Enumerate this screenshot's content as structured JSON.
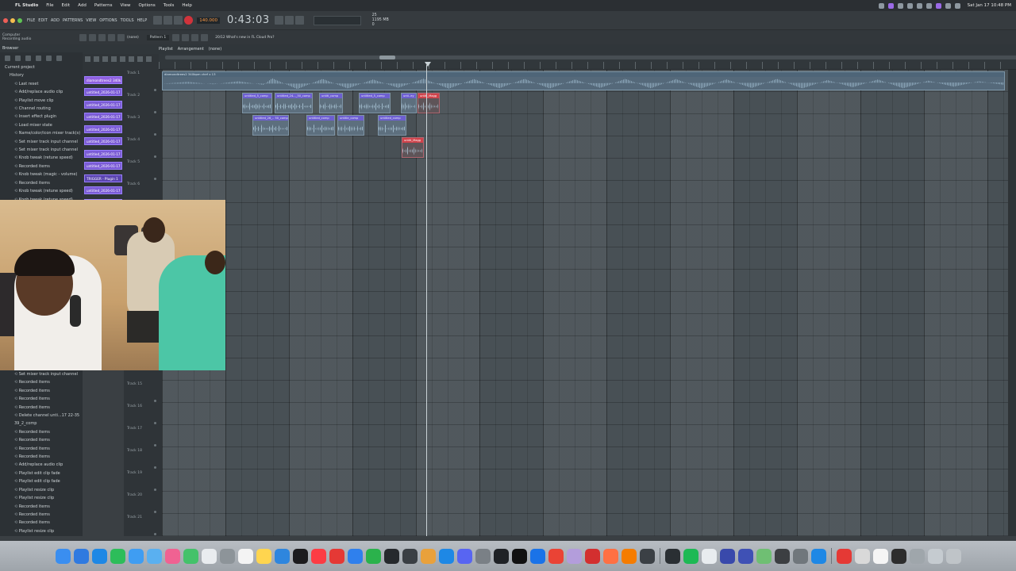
{
  "menubar": {
    "app": "FL Studio",
    "items": [
      "File",
      "Edit",
      "Add",
      "Patterns",
      "View",
      "Options",
      "Tools",
      "Help"
    ],
    "clock": "Sat Jan 17 10:48 PM"
  },
  "toolbar": {
    "menu": [
      "FILE",
      "EDIT",
      "ADD",
      "PATTERNS",
      "VIEW",
      "OPTIONS",
      "TOOLS",
      "HELP"
    ],
    "tempo": "140.000",
    "time": "0:43:03",
    "cpu": "25",
    "mem": "1195 MB",
    "voices": "0"
  },
  "toolbar2": {
    "status_line1": "Computer",
    "status_line2": "Recording audio",
    "pattern": "Pattern 1",
    "pattern_mode": "(none)",
    "hint": "20/12 What's new in FL Cloud Pro?"
  },
  "browser": {
    "title": "Browser",
    "tree": [
      {
        "text": "Current project",
        "level": 0
      },
      {
        "text": "History",
        "level": 1
      },
      {
        "text": "Last reset",
        "level": 2
      },
      {
        "text": "Add/replace audio clip",
        "level": 2
      },
      {
        "text": "Playlist move clip",
        "level": 2
      },
      {
        "text": "Channel routing",
        "level": 2
      },
      {
        "text": "Insert effect plugin",
        "level": 2
      },
      {
        "text": "Load mixer state",
        "level": 2
      },
      {
        "text": "Name/color/icon mixer track(s)",
        "level": 2
      },
      {
        "text": "Set mixer track input channel",
        "level": 2
      },
      {
        "text": "Set mixer track input channel",
        "level": 2
      },
      {
        "text": "Knob tweak (retune speed)",
        "level": 2
      },
      {
        "text": "Recorded items",
        "level": 2
      },
      {
        "text": "Knob tweak (magic - volume)",
        "level": 2
      },
      {
        "text": "Recorded items",
        "level": 2
      },
      {
        "text": "Knob tweak (retune speed)",
        "level": 2
      },
      {
        "text": "Knob tweak (retune speed)",
        "level": 2
      }
    ],
    "lower": [
      "Set mixer track input channel",
      "Recorded items",
      "Recorded items",
      "Recorded items",
      "Recorded items",
      "Delete channel unti...17 22-35 39_2_comp",
      "Recorded items",
      "Recorded items",
      "Recorded items",
      "Recorded items",
      "Add/replace audio clip",
      "Playlist edit clip fade",
      "Playlist edit clip fade",
      "Playlist resize clip",
      "Playlist resize clip",
      "Recorded items",
      "Recorded items",
      "Recorded items",
      "Playlist resize clip"
    ]
  },
  "picker": {
    "items": [
      "diamondtrees2 340k...",
      "untitled_2026-01-17 22...",
      "untitled_2026-01-17 22...",
      "untitled_2026-01-17 22...",
      "untitled_2026-01-17 22...",
      "untitled_2026-01-17 22...",
      "untitled_2026-01-17 22...",
      "untitled_2026-01-17 22...",
      "TRIGGER - Plugin 1",
      "untitled_2026-01-17 22...",
      "untitled_2026-01-17 22..."
    ]
  },
  "playlist": {
    "title": "Playlist",
    "subtitle": "Arrangement",
    "pattern": "(none)",
    "tracks": [
      "Track 1",
      "Track 2",
      "Track 3",
      "Track 4",
      "Track 5",
      "Track 6",
      "Track 15",
      "Track 16",
      "Track 17",
      "Track 18",
      "Track 19",
      "Track 20",
      "Track 21"
    ],
    "bigclip_label": "diamondtrees2 340bpm chef x 13",
    "clips": [
      {
        "label": "untitled_5_comp",
        "track": 2
      },
      {
        "label": "untitled_24..._50_comp",
        "track": 2
      },
      {
        "label": "untitl_comp",
        "track": 2
      },
      {
        "label": "untitled_5_comp",
        "track": 2
      },
      {
        "label": "unti..ey",
        "track": 2
      },
      {
        "label": "untitl_Magg",
        "track": 2,
        "red": true
      },
      {
        "label": "untitled_26_.. 50_comp",
        "track": 3
      },
      {
        "label": "untitled_comp",
        "track": 3
      },
      {
        "label": "untitle_comp",
        "track": 3
      },
      {
        "label": "untitled_comp",
        "track": 3
      },
      {
        "label": "untitl_Magg",
        "track": 4,
        "red": true
      }
    ]
  }
}
